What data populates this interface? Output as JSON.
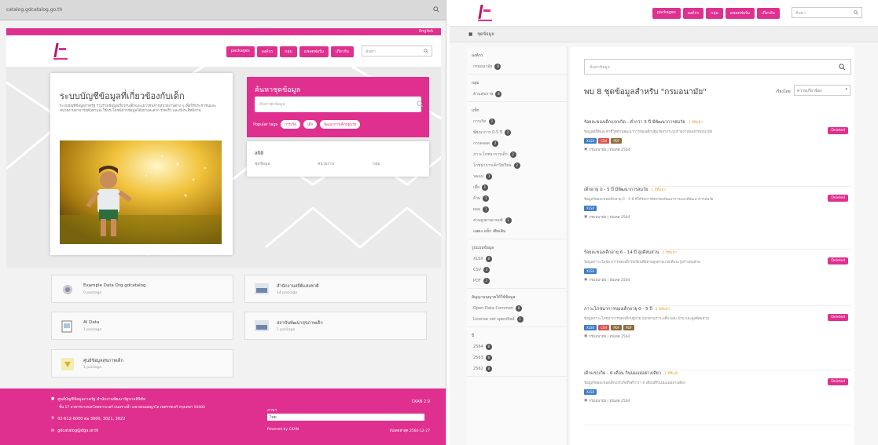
{
  "left": {
    "url": "catalog.gdcatalog.go.th",
    "topbar_text": "English",
    "nav": [
      "packages",
      "องค์กร",
      "กลุ่ม",
      "แพลตฟอร์ม",
      "เกี่ยวกับ"
    ],
    "search_placeholder": "ค้นหา",
    "hero_title": "ระบบบัญชีข้อมูลที่เกี่ยวข้องกับเด็ก",
    "hero_desc": "ระบบบัญชีข้อมูลภาครัฐ รวบรวมข้อมูลเกี่ยวกับเด็กและเยาวชนจากหน่วยงานต่าง ๆ เพื่อให้ประชาชนและหน่วยงานสามารถค้นหาและใช้ประโยชน์จากข้อมูลได้อย่างสะดวก รวดเร็ว และมีประสิทธิภาพ",
    "find_title": "ค้นหาชุดข้อมูล",
    "find_placeholder": "ค้นหาชุดข้อมูล",
    "popular_label": "Popular tags",
    "popular_tags": [
      "การเกิด",
      "เด็ก",
      "พัฒนาการเด็กปฐมวัย"
    ],
    "stats_title": "สถิติ",
    "stats": [
      "ชุดข้อมูล",
      "หน่วยงาน",
      "กลุ่ม"
    ],
    "tiles": [
      {
        "title": "Example Data Org gdcatalog",
        "sub": "0 package"
      },
      {
        "title": "สำนักงานสถิติแห่งชาติ",
        "sub": "14 package"
      },
      {
        "title": "AI Data",
        "sub": "1 package"
      },
      {
        "title": "สถาบันพัฒนาสุขภาพเด็ก",
        "sub": "1 package"
      },
      {
        "title": "ศูนย์ข้อมูลสุขภาพเด็ก",
        "sub": "1 package"
      }
    ],
    "footer": {
      "address": "ศูนย์บัญชีข้อมูลภาครัฐ สำนักงานพัฒนารัฐบาลดิจิทัล",
      "address2": "ชั้น 17 อาคารบางกอกไทยทาวเวอร์ ถนนรางน้ำ แขวงถนนพญาไท เขตราชเทวี กรุงเทพฯ 10400",
      "phone": "02-612-6000 ต่อ 3000, 3021, 3022",
      "email": "gdcatalog@dga.or.th",
      "version": "CKAN 2.9",
      "lang_label": "ภาษา",
      "lang": "ไทย",
      "powered": "Powered by CKAN",
      "updated": "อัปเดตล่าสุด 2564-12-27"
    }
  },
  "right": {
    "nav": [
      "packages",
      "องค์กร",
      "กลุ่ม",
      "แพลตฟอร์ม",
      "เกี่ยวกับ"
    ],
    "search_placeholder": "ค้นหา",
    "breadcrumb": "ชุดข้อมูล",
    "facets": [
      {
        "title": "องค์กร",
        "items": [
          {
            "label": "กรมอนามัย",
            "count": "8"
          }
        ]
      },
      {
        "title": "กลุ่ม",
        "items": [
          {
            "label": "ด้านสุขภาพ",
            "count": "8"
          }
        ]
      },
      {
        "title": "แท็ก",
        "items": [
          {
            "label": "การเกิด",
            "count": "3"
          },
          {
            "label": "พัฒนาการ 0-5 ปี",
            "count": "2"
          },
          {
            "label": "การคลอด",
            "count": "2"
          },
          {
            "label": "ภาวะโภชนาการเด็ก",
            "count": "2"
          },
          {
            "label": "โภชนาการเด็กวัยเรียน",
            "count": "2"
          },
          {
            "label": "นมแม่",
            "count": "1"
          },
          {
            "label": "เตี้ย",
            "count": "1"
          },
          {
            "label": "อ้วน",
            "count": "1"
          },
          {
            "label": "ผอม",
            "count": "1"
          },
          {
            "label": "ส่วนสูงตามเกณฑ์",
            "count": "1"
          }
        ],
        "more": "แสดง แท็ก เพิ่มเติม"
      },
      {
        "title": "รูปแบบข้อมูล",
        "items": [
          {
            "label": "XLSX",
            "count": "8"
          },
          {
            "label": "CSV",
            "count": "3"
          },
          {
            "label": "PDF",
            "count": "2"
          }
        ]
      },
      {
        "title": "สัญญาอนุญาตให้ใช้ข้อมูล",
        "items": [
          {
            "label": "Open Data Common",
            "count": "8"
          },
          {
            "label": "License not specified",
            "count": "1"
          }
        ]
      },
      {
        "title": "ปี",
        "items": [
          {
            "label": "2564",
            "count": "8"
          },
          {
            "label": "2563",
            "count": "8"
          },
          {
            "label": "2562",
            "count": "8"
          }
        ]
      }
    ],
    "main_search_placeholder": "ค้นหาข้อมูล",
    "results_title": "พบ 8 ชุดข้อมูลสำหรับ \"กรมอนามัย\"",
    "sort_label": "เรียงโดย",
    "sort_value": "ความเกี่ยวข้อง",
    "results": [
      {
        "title": "ร้อยละของเด็กแรกเกิด - ต่ำกว่า 5 ปี มีพัฒนาการสมวัย",
        "age": "1 ปีที่แล้ว",
        "badge": "Deleted",
        "desc": "ข้อมูลสถิติและตัวชี้วัดด้านพัฒนาการของเด็กปฐมวัยจากระบบรายงานของกรมอนามัย",
        "formats": [
          "XLSX",
          "CSV",
          "PDF"
        ],
        "meta": "กรมอนามัย | อัปเดต 2564"
      },
      {
        "title": "เด็กอายุ 0 - 5 ปี มีพัฒนาการสมวัย",
        "age": "1 ปีที่แล้ว",
        "badge": "Deleted",
        "desc": "ข้อมูลร้อยละของเด็กอายุ 0 - 5 ปี ที่ได้รับการคัดกรองพัฒนาการและมีพัฒนาการสมวัย",
        "formats": [
          "XLSX"
        ],
        "meta": "กรมอนามัย | อัปเดต 2564"
      },
      {
        "title": "ร้อยละของเด็กอายุ 6 - 14 ปี สูงดีสมส่วน",
        "age": "1 ปีที่แล้ว",
        "badge": "Deleted",
        "desc": "ข้อมูลภาวะโภชนาการของเด็กวัยเรียนที่มีส่วนสูงตามเกณฑ์และรูปร่างสมส่วน",
        "formats": [
          "XLSX"
        ],
        "meta": "กรมอนามัย | อัปเดต 2564"
      },
      {
        "title": "ภาวะโภชนาการของเด็กอายุ 0 - 5 ปี",
        "age": "1 ปีที่แล้ว",
        "badge": "Deleted",
        "desc": "ข้อมูลภาวะโภชนาการของเด็กปฐมวัย แยกตามภาวะเตี้ย ผอม อ้วน และสูงดีสมส่วน",
        "formats": [
          "XLSX",
          "CSV",
          "PDF",
          "PDF"
        ],
        "meta": "กรมอนามัย | อัปเดต 2564"
      },
      {
        "title": "เด็กแรกเกิด - 6 เดือน กินนมแม่อย่างเดียว",
        "age": "1 ปีที่แล้ว",
        "badge": "Deleted",
        "desc": "ข้อมูลร้อยละของเด็กแรกเกิดถึงต่ำกว่า 6 เดือนที่กินนมแม่อย่างเดียว",
        "formats": [
          "XLSX"
        ],
        "meta": "กรมอนามัย | อัปเดต 2564"
      }
    ],
    "colors": {
      "accent": "#e0308f",
      "xlsx": "#3b7dc4",
      "csv": "#d9534f",
      "pdf": "#8b6d3f"
    }
  }
}
